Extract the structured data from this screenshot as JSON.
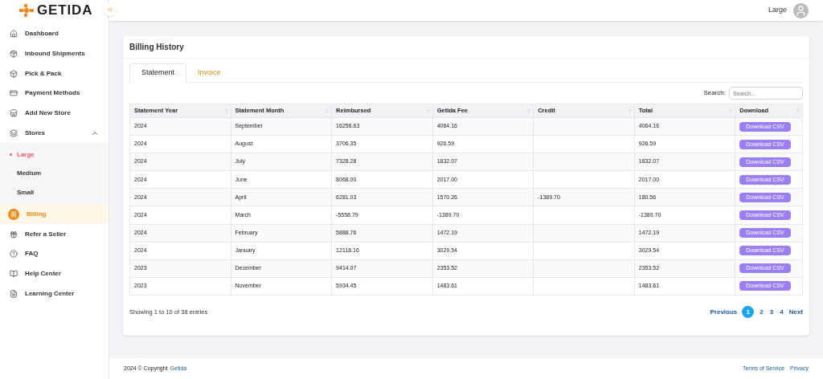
{
  "logo": {
    "text": "GETIDA"
  },
  "user": {
    "name": "Large"
  },
  "sidebar": {
    "items": [
      {
        "label": "Dashboard",
        "selected": false
      },
      {
        "label": "Inbound Shipments",
        "selected": false
      },
      {
        "label": "Pick & Pack",
        "selected": false
      },
      {
        "label": "Payment Methods",
        "selected": false
      },
      {
        "label": "Add New Store",
        "selected": false
      },
      {
        "label": "Stores",
        "selected": false,
        "expanded": true,
        "children": [
          {
            "label": "Large",
            "selected": true
          },
          {
            "label": "Medium",
            "selected": false
          },
          {
            "label": "Small",
            "selected": false
          }
        ]
      },
      {
        "label": "Billing",
        "selected": true
      },
      {
        "label": "Refer a Seller",
        "selected": false
      },
      {
        "label": "FAQ",
        "selected": false
      },
      {
        "label": "Help Center",
        "selected": false
      },
      {
        "label": "Learning Center",
        "selected": false
      }
    ]
  },
  "page": {
    "title": "Billing History"
  },
  "tabs": [
    {
      "label": "Statement",
      "selected": true
    },
    {
      "label": "Invoice",
      "selected": false
    }
  ],
  "search": {
    "label": "Search:",
    "placeholder": "Search..."
  },
  "table": {
    "columns": [
      "Statement Year",
      "Statement Month",
      "Reimbursed",
      "Getida Fee",
      "Credit",
      "Total",
      "Download"
    ],
    "rows": [
      [
        "2024",
        "September",
        "16256.63",
        "4064.16",
        "",
        "4064.16",
        "Download CSV"
      ],
      [
        "2024",
        "August",
        "3706.35",
        "926.59",
        "",
        "926.59",
        "Download CSV"
      ],
      [
        "2024",
        "July",
        "7328.28",
        "1832.07",
        "",
        "1832.07",
        "Download CSV"
      ],
      [
        "2024",
        "June",
        "8068.00",
        "2017.00",
        "",
        "2017.00",
        "Download CSV"
      ],
      [
        "2024",
        "April",
        "6281.03",
        "1570.26",
        "-1389.70",
        "180.56",
        "Download CSV"
      ],
      [
        "2024",
        "March",
        "-5558.79",
        "-1389.70",
        "",
        "-1389.70",
        "Download CSV"
      ],
      [
        "2024",
        "February",
        "5888.76",
        "1472.19",
        "",
        "1472.19",
        "Download CSV"
      ],
      [
        "2024",
        "January",
        "12118.16",
        "3029.54",
        "",
        "3029.54",
        "Download CSV"
      ],
      [
        "2023",
        "December",
        "9414.07",
        "2353.52",
        "",
        "2353.52",
        "Download CSV"
      ],
      [
        "2023",
        "November",
        "5934.45",
        "1483.61",
        "",
        "1483.61",
        "Download CSV"
      ]
    ]
  },
  "info": "Showing 1 to 10 of 38 entries",
  "pagination": {
    "previous": "Previous",
    "next": "Next",
    "pages": [
      {
        "label": "1",
        "selected": true
      },
      {
        "label": "2",
        "selected": false
      },
      {
        "label": "3",
        "selected": false
      },
      {
        "label": "4",
        "selected": false
      }
    ]
  },
  "footer": {
    "copyright": "2024 © Copyright",
    "brand": "Getida",
    "links": [
      "Terms of Service",
      "Privacy"
    ]
  }
}
